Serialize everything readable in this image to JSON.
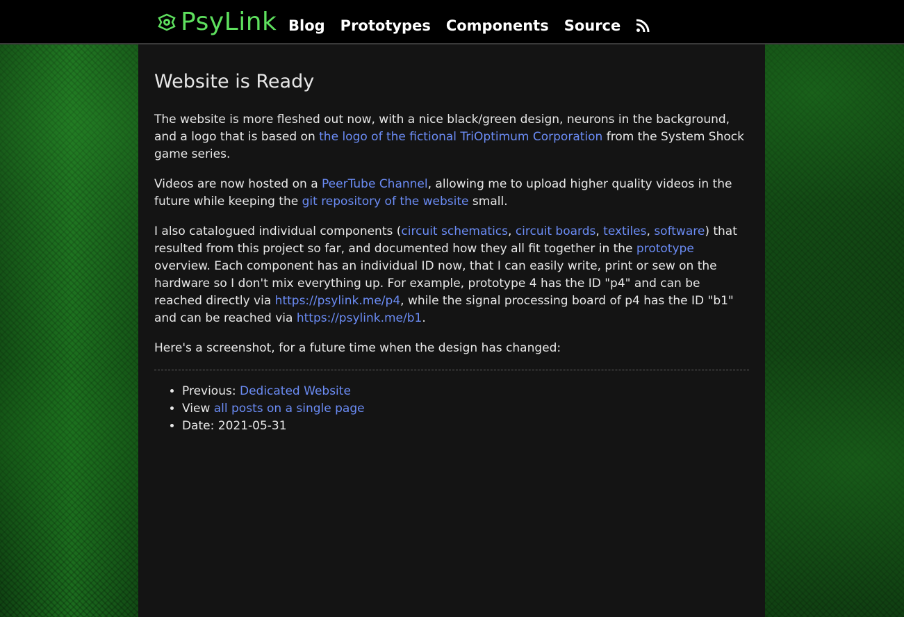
{
  "header": {
    "brand": "PsyLink",
    "nav": [
      "Blog",
      "Prototypes",
      "Components",
      "Source"
    ],
    "rss_icon": "rss-icon",
    "logo_icon": "triopt-logo-icon"
  },
  "post": {
    "title": "Website is Ready",
    "p1": {
      "t1": "The website is more fleshed out now, with a nice black/green design, neurons in the background, and a logo that is based on ",
      "link": "the logo of the fictional TriOptimum Corporation",
      "t2": " from the System Shock game series."
    },
    "p2": {
      "t1": "Videos are now hosted on a ",
      "link1": "PeerTube Channel",
      "t2": ", allowing me to upload higher quality videos in the future while keeping the ",
      "link2": "git repository of the website",
      "t3": " small."
    },
    "p3": {
      "t1": "I also catalogued individual components (",
      "link1": "circuit schematics",
      "sep1": ", ",
      "link2": "circuit boards",
      "sep2": ", ",
      "link3": "textiles",
      "sep3": ", ",
      "link4": "software",
      "t2": ") that resulted from this project so far, and documented how they all fit together in the ",
      "link5": "prototype",
      "t3": " overview. Each component has an individual ID now, that I can easily write, print or sew on the hardware so I don't mix everything up. For example, prototype 4 has the ID \"p4\" and can be reached directly via ",
      "link6": "https://psylink.me/p4",
      "t4": ", while the signal processing board of p4 has the ID \"b1\" and can be reached via ",
      "link7": "https://psylink.me/b1",
      "t5": "."
    },
    "p4": "Here's a screenshot, for a future time when the design has changed:"
  },
  "meta": {
    "prev_label": "Previous: ",
    "prev_link": "Dedicated Website",
    "view_label": "View ",
    "view_link": "all posts on a single page",
    "date": "Date: 2021-05-31"
  },
  "colors": {
    "accent_green": "#5ee05e",
    "link_blue": "#6b8cf5",
    "panel": "#141414"
  }
}
